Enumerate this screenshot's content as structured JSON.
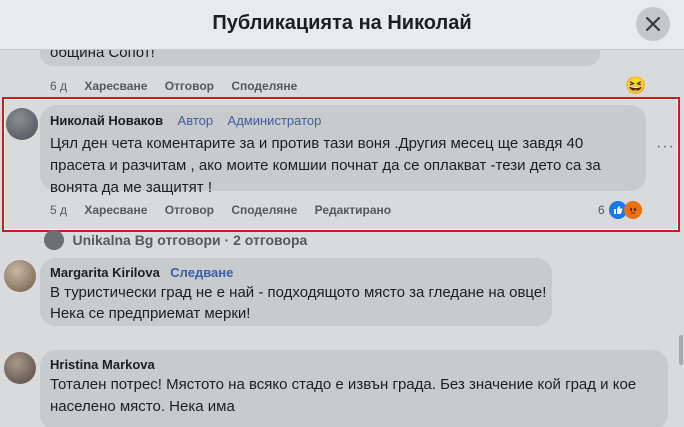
{
  "header": {
    "title": "Публикацията на Николай"
  },
  "prev_comment": {
    "text_tail": "община Сопот!",
    "time": "6 д",
    "actions": [
      "Харесване",
      "Отговор",
      "Споделяне"
    ],
    "reaction": "😆"
  },
  "main_comment": {
    "author": "Николай Новаков",
    "badges": [
      "Автор",
      "Администратор"
    ],
    "text": "Цял ден чета коментарите за и против тази воня .Другия месец ще завдя 40 прасета и разчитам , ако моите комшии почнат да се оплакват -тези дето са за вонята да ме защитят !",
    "time": "5 д",
    "actions": [
      "Харесване",
      "Отговор",
      "Споделяне",
      "Редактирано"
    ],
    "reaction_count": "6",
    "reactions": [
      "like",
      "angry"
    ]
  },
  "replies_summary": {
    "text": "Unikalna Bg отговори · 2 отговора"
  },
  "comment2": {
    "author": "Margarita Kirilova",
    "follow": "Следване",
    "text1": "В туристически град не е най - подходящото място за гледане на овце!",
    "text2": "Нека се предприемат мерки!"
  },
  "comment3": {
    "author": "Hristina Markova",
    "text": "Тотален потрес! Мястото на всяко стадо е извън града. Без значение кой град и кое населено място. Нека има"
  },
  "colors": {
    "highlight": "#d11a1a",
    "accent": "#3b5fa8",
    "like": "#1877f2",
    "angry": "#e9710f"
  }
}
